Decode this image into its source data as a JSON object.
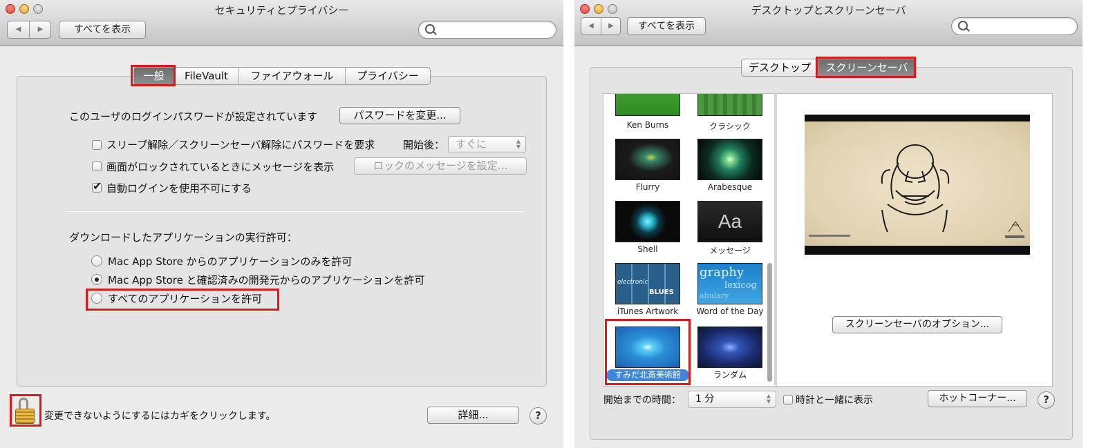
{
  "left_window": {
    "title": "セキュリティとプライバシー",
    "show_all": "すべてを表示",
    "tabs": [
      {
        "label": "一般",
        "selected": true
      },
      {
        "label": "FileVault",
        "selected": false
      },
      {
        "label": "ファイアウォール",
        "selected": false
      },
      {
        "label": "プライバシー",
        "selected": false
      }
    ],
    "password_set_text": "このユーザのログインパスワードが設定されています",
    "change_password_button": "パスワードを変更...",
    "require_password_label": "スリープ解除／スクリーンセーバ解除にパスワードを要求",
    "require_password_checked": false,
    "start_after_label": "開始後：",
    "start_after_value": "すぐに",
    "lock_message_label": "画面がロックされているときにメッセージを表示",
    "lock_message_checked": false,
    "set_lock_message_button": "ロックのメッセージを設定...",
    "disable_autologin_label": "自動ログインを使用不可にする",
    "disable_autologin_checked": true,
    "downloads_heading": "ダウンロードしたアプリケーションの実行許可：",
    "radio_options": [
      {
        "label": "Mac App Store からのアプリケーションのみを許可",
        "selected": false
      },
      {
        "label": "Mac App Store と確認済みの開発元からのアプリケーションを許可",
        "selected": true
      },
      {
        "label": "すべてのアプリケーションを許可",
        "selected": false
      }
    ],
    "lock_text": "変更できないようにするにはカギをクリックします。",
    "advanced_button": "詳細...",
    "help": "?"
  },
  "right_window": {
    "title": "デスクトップとスクリーンセーバ",
    "show_all": "すべてを表示",
    "tabs": [
      {
        "label": "デスクトップ",
        "selected": false
      },
      {
        "label": "スクリーンセーバ",
        "selected": true
      }
    ],
    "savers": [
      "Ken Burns",
      "クラシック",
      "Flurry",
      "Arabesque",
      "Shell",
      "メッセージ",
      "iTunes Artwork",
      "Word of the Day",
      "すみだ北斎美術館",
      "ランダム"
    ],
    "selected_saver": "すみだ北斎美術館",
    "message_thumb_text": "Aa",
    "word_thumb_text": [
      "graphy",
      "lexicog",
      "abulary"
    ],
    "itunes_thumb_text": [
      "BLUES",
      "electronic"
    ],
    "options_button": "スクリーンセーバのオプション...",
    "start_after_label": "開始までの時間：",
    "start_after_value": "1 分",
    "show_clock_label": "時計と一緒に表示",
    "show_clock_checked": false,
    "hot_corners_button": "ホットコーナー...",
    "help": "?"
  },
  "colors": {
    "highlight_red": "#d91a1a",
    "selection_blue": "#3d86d9",
    "window_bg": "#ececec",
    "panel_bg": "#e4e4e4"
  }
}
